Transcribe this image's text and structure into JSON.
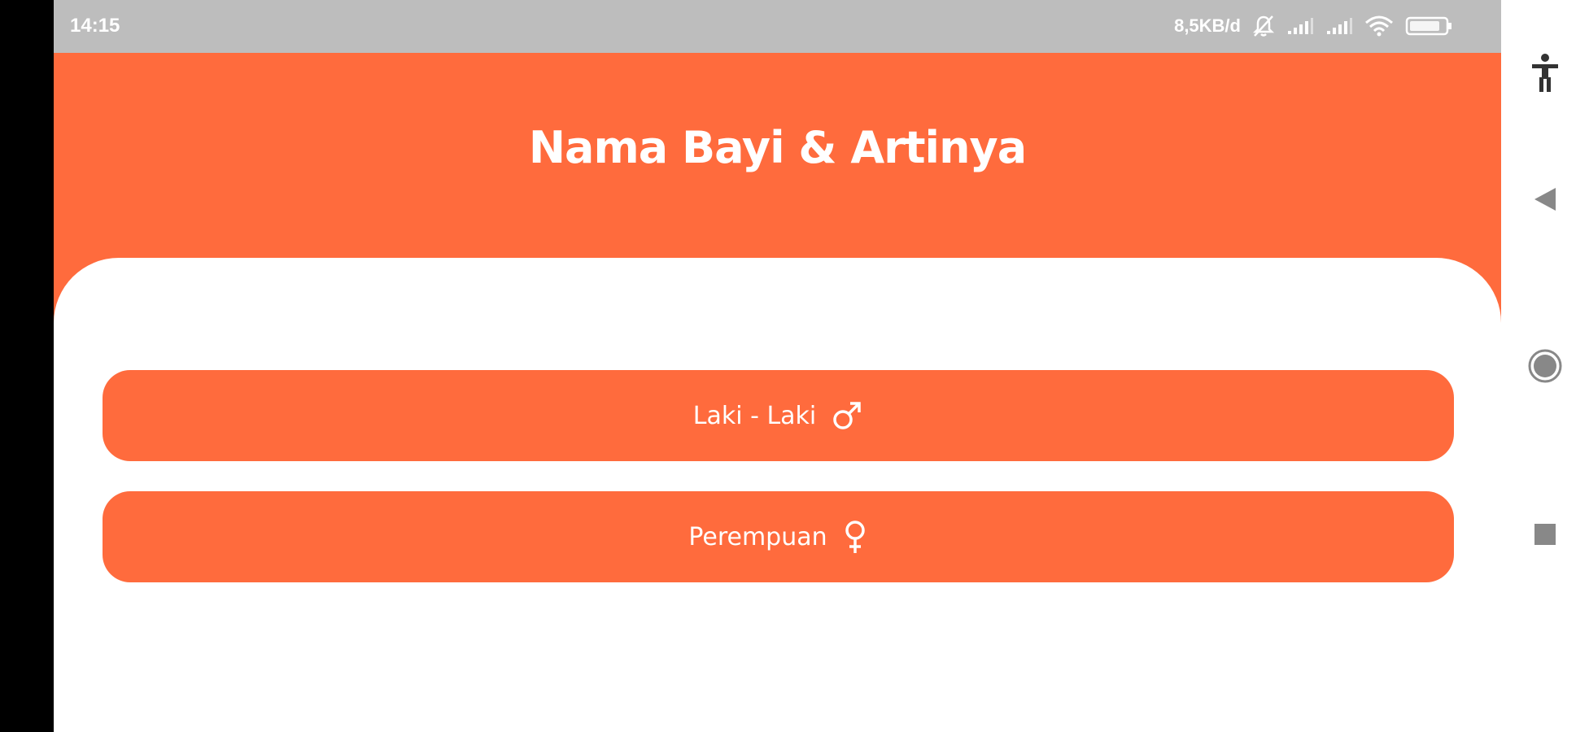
{
  "status_bar": {
    "time": "14:15",
    "network_speed": "8,5KB/d",
    "icons": [
      "mute-notification-icon",
      "signal-icon",
      "signal-icon",
      "wifi-icon",
      "battery-icon"
    ]
  },
  "app": {
    "title": "Nama Bayi & Artinya",
    "buttons": [
      {
        "label": "Laki - Laki",
        "icon": "male-symbol-icon"
      },
      {
        "label": "Perempuan",
        "icon": "female-symbol-icon"
      }
    ]
  },
  "nav_bar": {
    "items": [
      "accessibility-icon",
      "back-icon",
      "home-icon",
      "recents-icon"
    ]
  },
  "colors": {
    "accent": "#ff6b3d",
    "status_bar": "#bdbdbd",
    "background": "#ffffff"
  }
}
